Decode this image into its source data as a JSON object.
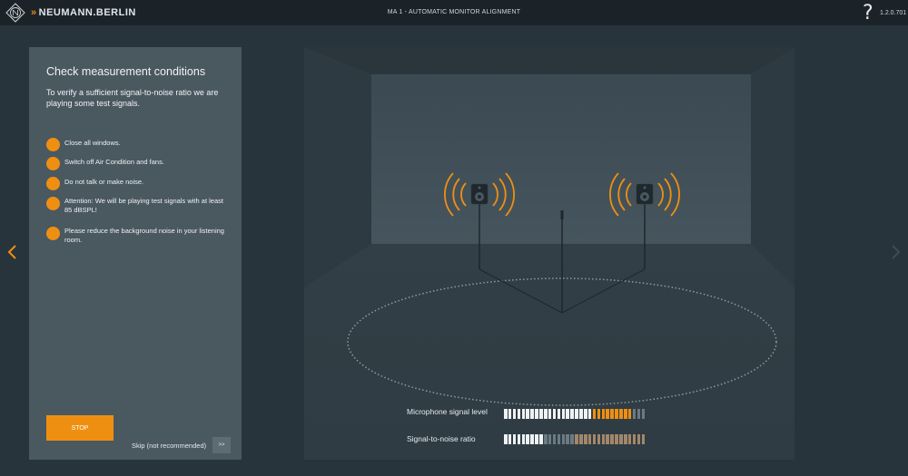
{
  "header": {
    "brand": "NEUMANN.BERLIN",
    "title": "MA 1 - AUTOMATIC MONITOR ALIGNMENT",
    "help_symbol": "?",
    "version": "1.2.0.701"
  },
  "panel": {
    "title": "Check measurement conditions",
    "subtitle": "To verify a sufficient signal-to-noise ratio we are playing some test signals.",
    "conditions": [
      "Close all windows.",
      "Switch off Air Condition and fans.",
      "Do not talk or make noise.",
      "Attention: We will be playing test signals with at least 85 dBSPL!",
      "Please reduce the background noise in your listening room."
    ],
    "stop_label": "STOP",
    "skip_label": "Skip (not recommended)",
    "skip_button": ">>"
  },
  "meters": {
    "mic_label": "Microphone signal level",
    "snr_label": "Signal-to-noise ratio",
    "segments_total": 32,
    "mic_segments": [
      "white",
      "white",
      "white",
      "white",
      "white",
      "white",
      "white",
      "white",
      "white",
      "white",
      "white",
      "white",
      "white",
      "white",
      "white",
      "white",
      "white",
      "white",
      "white",
      "white",
      "orange",
      "orange",
      "orange",
      "orange",
      "orange",
      "orange",
      "orange",
      "orange",
      "orange",
      "grey",
      "grey",
      "grey"
    ],
    "snr_segments": [
      "white",
      "white",
      "white",
      "white",
      "white",
      "white",
      "white",
      "white",
      "white",
      "grey",
      "grey",
      "grey",
      "grey",
      "grey",
      "grey",
      "grey",
      "tan",
      "tan",
      "tan",
      "tan",
      "tan",
      "tan",
      "tan",
      "tan",
      "tan",
      "tan",
      "tan",
      "tan",
      "tan",
      "tan",
      "tan",
      "tan"
    ]
  },
  "colors": {
    "accent": "#ef8f12",
    "segment_white": "#eef2f4",
    "segment_orange": "#ef8f12",
    "segment_grey": "#6b7a83",
    "segment_tan": "#a3876a",
    "background": "#27343b",
    "panel": "#4a5860"
  },
  "icons": {
    "logo": "neumann-logo-icon",
    "prev": "chevron-left-icon",
    "next": "chevron-right-icon",
    "bullet": "orange-dot-icon",
    "speaker": "speaker-icon",
    "microphone": "microphone-stand-icon"
  }
}
